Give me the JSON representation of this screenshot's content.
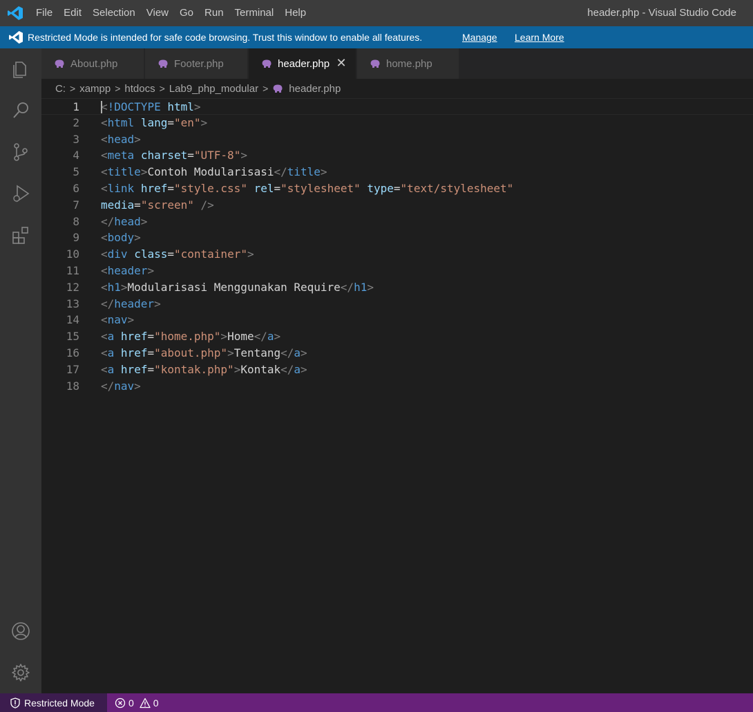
{
  "titlebar": {
    "menu": [
      "File",
      "Edit",
      "Selection",
      "View",
      "Go",
      "Run",
      "Terminal",
      "Help"
    ],
    "window_title": "header.php - Visual Studio Code"
  },
  "banner": {
    "message": "Restricted Mode is intended for safe code browsing. Trust this window to enable all features.",
    "manage": "Manage",
    "learn_more": "Learn More"
  },
  "activity_icons": [
    "explorer-icon",
    "search-icon",
    "source-control-icon",
    "run-debug-icon",
    "extensions-icon",
    "accounts-icon",
    "settings-gear-icon"
  ],
  "tabs": [
    {
      "label": "About.php",
      "active": false
    },
    {
      "label": "Footer.php",
      "active": false
    },
    {
      "label": "header.php",
      "active": true,
      "close": "✕"
    },
    {
      "label": "home.php",
      "active": false
    }
  ],
  "breadcrumb": [
    "C:",
    "xampp",
    "htdocs",
    "Lab9_php_modular",
    "header.php"
  ],
  "breadcrumb_sep": ">",
  "editor": {
    "line_numbers": [
      "1",
      "2",
      "3",
      "4",
      "5",
      "6",
      "7",
      "8",
      "9",
      "10",
      "11",
      "12",
      "13",
      "14",
      "15",
      "16",
      "17",
      "18"
    ],
    "current_line": 1,
    "lines": [
      [
        [
          "b",
          "<"
        ],
        [
          "t",
          "!DOCTYPE"
        ],
        [
          "x",
          " "
        ],
        [
          "a",
          "html"
        ],
        [
          "b",
          ">"
        ]
      ],
      [
        [
          "b",
          "<"
        ],
        [
          "t",
          "html"
        ],
        [
          "x",
          " "
        ],
        [
          "a",
          "lang"
        ],
        [
          "x",
          "="
        ],
        [
          "s",
          "\"en\""
        ],
        [
          "b",
          ">"
        ]
      ],
      [
        [
          "b",
          "<"
        ],
        [
          "t",
          "head"
        ],
        [
          "b",
          ">"
        ]
      ],
      [
        [
          "b",
          "<"
        ],
        [
          "t",
          "meta"
        ],
        [
          "x",
          " "
        ],
        [
          "a",
          "charset"
        ],
        [
          "x",
          "="
        ],
        [
          "s",
          "\"UTF-8\""
        ],
        [
          "b",
          ">"
        ]
      ],
      [
        [
          "b",
          "<"
        ],
        [
          "t",
          "title"
        ],
        [
          "b",
          ">"
        ],
        [
          "x",
          "Contoh Modularisasi"
        ],
        [
          "b",
          "</"
        ],
        [
          "t",
          "title"
        ],
        [
          "b",
          ">"
        ]
      ],
      [
        [
          "b",
          "<"
        ],
        [
          "t",
          "link"
        ],
        [
          "x",
          " "
        ],
        [
          "a",
          "href"
        ],
        [
          "x",
          "="
        ],
        [
          "s",
          "\"style.css\""
        ],
        [
          "x",
          " "
        ],
        [
          "a",
          "rel"
        ],
        [
          "x",
          "="
        ],
        [
          "s",
          "\"stylesheet\""
        ],
        [
          "x",
          " "
        ],
        [
          "a",
          "type"
        ],
        [
          "x",
          "="
        ],
        [
          "s",
          "\"text/stylesheet\""
        ]
      ],
      [
        [
          "a",
          "media"
        ],
        [
          "x",
          "="
        ],
        [
          "s",
          "\"screen\""
        ],
        [
          "x",
          " "
        ],
        [
          "b",
          "/>"
        ]
      ],
      [
        [
          "b",
          "</"
        ],
        [
          "t",
          "head"
        ],
        [
          "b",
          ">"
        ]
      ],
      [
        [
          "b",
          "<"
        ],
        [
          "t",
          "body"
        ],
        [
          "b",
          ">"
        ]
      ],
      [
        [
          "b",
          "<"
        ],
        [
          "t",
          "div"
        ],
        [
          "x",
          " "
        ],
        [
          "a",
          "class"
        ],
        [
          "x",
          "="
        ],
        [
          "s",
          "\"container\""
        ],
        [
          "b",
          ">"
        ]
      ],
      [
        [
          "b",
          "<"
        ],
        [
          "t",
          "header"
        ],
        [
          "b",
          ">"
        ]
      ],
      [
        [
          "b",
          "<"
        ],
        [
          "t",
          "h1"
        ],
        [
          "b",
          ">"
        ],
        [
          "x",
          "Modularisasi Menggunakan Require"
        ],
        [
          "b",
          "</"
        ],
        [
          "t",
          "h1"
        ],
        [
          "b",
          ">"
        ]
      ],
      [
        [
          "b",
          "</"
        ],
        [
          "t",
          "header"
        ],
        [
          "b",
          ">"
        ]
      ],
      [
        [
          "b",
          "<"
        ],
        [
          "t",
          "nav"
        ],
        [
          "b",
          ">"
        ]
      ],
      [
        [
          "b",
          "<"
        ],
        [
          "t",
          "a"
        ],
        [
          "x",
          " "
        ],
        [
          "a",
          "href"
        ],
        [
          "x",
          "="
        ],
        [
          "s",
          "\"home.php\""
        ],
        [
          "b",
          ">"
        ],
        [
          "x",
          "Home"
        ],
        [
          "b",
          "</"
        ],
        [
          "t",
          "a"
        ],
        [
          "b",
          ">"
        ]
      ],
      [
        [
          "b",
          "<"
        ],
        [
          "t",
          "a"
        ],
        [
          "x",
          " "
        ],
        [
          "a",
          "href"
        ],
        [
          "x",
          "="
        ],
        [
          "s",
          "\"about.php\""
        ],
        [
          "b",
          ">"
        ],
        [
          "x",
          "Tentang"
        ],
        [
          "b",
          "</"
        ],
        [
          "t",
          "a"
        ],
        [
          "b",
          ">"
        ]
      ],
      [
        [
          "b",
          "<"
        ],
        [
          "t",
          "a"
        ],
        [
          "x",
          " "
        ],
        [
          "a",
          "href"
        ],
        [
          "x",
          "="
        ],
        [
          "s",
          "\"kontak.php\""
        ],
        [
          "b",
          ">"
        ],
        [
          "x",
          "Kontak"
        ],
        [
          "b",
          "</"
        ],
        [
          "t",
          "a"
        ],
        [
          "b",
          ">"
        ]
      ],
      [
        [
          "b",
          "</"
        ],
        [
          "t",
          "nav"
        ],
        [
          "b",
          ">"
        ]
      ]
    ]
  },
  "statusbar": {
    "restricted": "Restricted Mode",
    "errors": "0",
    "warnings": "0"
  },
  "colors": {
    "titlebar": "#3c3c3c",
    "banner": "#0e639c",
    "activitybar": "#333333",
    "editor_bg": "#1e1e1e",
    "statusbar": "#68217a",
    "tag": "#569cd6",
    "attribute": "#9cdcfe",
    "string": "#ce9178",
    "php_icon": "#a074c4"
  }
}
